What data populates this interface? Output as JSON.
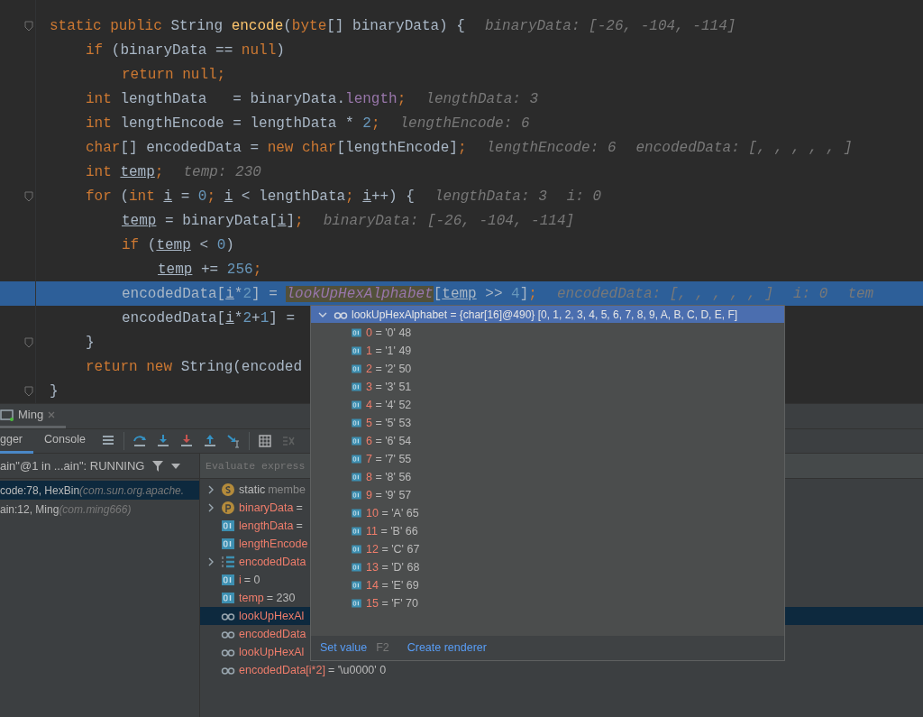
{
  "editor": {
    "lines": [
      {
        "tokens": [
          {
            "text": "static public ",
            "kind": "keyword"
          },
          {
            "text": "String ",
            "kind": "plain"
          },
          {
            "text": "encode",
            "kind": "method"
          },
          {
            "text": "(",
            "kind": "plain"
          },
          {
            "text": "byte",
            "kind": "keyword"
          },
          {
            "text": "[] binaryData) {",
            "kind": "plain"
          }
        ],
        "hints": [
          "binaryData: [-26, -104, -114]"
        ],
        "current": false,
        "fold": true,
        "children": [
          {
            "tokens": [
              {
                "text": "if",
                "kind": "keyword"
              },
              {
                "text": " (binaryData == ",
                "kind": "plain"
              },
              {
                "text": "null",
                "kind": "keyword"
              },
              {
                "text": ")",
                "kind": "plain"
              }
            ],
            "current": false,
            "fold": false,
            "children": [
              {
                "tokens": [
                  {
                    "text": "return null;",
                    "kind": "keyword"
                  }
                ],
                "current": false,
                "fold": false
              }
            ]
          },
          {
            "tokens": [
              {
                "text": "int",
                "kind": "keyword"
              },
              {
                "text": " lengthData   = binaryData.",
                "kind": "plain"
              },
              {
                "text": "length",
                "kind": "field"
              },
              {
                "text": ";",
                "kind": "keyword"
              }
            ],
            "hints": [
              "lengthData: 3"
            ],
            "current": false,
            "fold": false
          },
          {
            "tokens": [
              {
                "text": "int",
                "kind": "keyword"
              },
              {
                "text": " lengthEncode = lengthData * ",
                "kind": "plain"
              },
              {
                "text": "2",
                "kind": "number"
              },
              {
                "text": ";",
                "kind": "keyword"
              }
            ],
            "hints": [
              "lengthEncode: 6"
            ],
            "current": false,
            "fold": false
          },
          {
            "tokens": [
              {
                "text": "char",
                "kind": "keyword"
              },
              {
                "text": "[] encodedData = ",
                "kind": "plain"
              },
              {
                "text": "new char",
                "kind": "keyword"
              },
              {
                "text": "[lengthEncode]",
                "kind": "plain"
              },
              {
                "text": ";",
                "kind": "keyword"
              }
            ],
            "hints": [
              "lengthEncode: 6",
              "encodedData: [, , , , , ]"
            ],
            "current": false,
            "fold": false
          },
          {
            "tokens": [
              {
                "text": "int ",
                "kind": "keyword"
              },
              {
                "text": "temp",
                "kind": "variable"
              },
              {
                "text": ";",
                "kind": "keyword"
              }
            ],
            "hints": [
              "temp: 230"
            ],
            "current": false,
            "fold": false
          },
          {
            "tokens": [
              {
                "text": "for",
                "kind": "keyword"
              },
              {
                "text": " (",
                "kind": "plain"
              },
              {
                "text": "int ",
                "kind": "keyword"
              },
              {
                "text": "i",
                "kind": "variable"
              },
              {
                "text": " = ",
                "kind": "plain"
              },
              {
                "text": "0",
                "kind": "number"
              },
              {
                "text": "; ",
                "kind": "keyword"
              },
              {
                "text": "i",
                "kind": "variable"
              },
              {
                "text": " < lengthData",
                "kind": "plain"
              },
              {
                "text": "; ",
                "kind": "keyword"
              },
              {
                "text": "i",
                "kind": "variable"
              },
              {
                "text": "++) {",
                "kind": "plain"
              }
            ],
            "hints": [
              "lengthData: 3",
              "i: 0"
            ],
            "current": false,
            "fold": true,
            "children": [
              {
                "tokens": [
                  {
                    "text": "temp",
                    "kind": "variable"
                  },
                  {
                    "text": " = binaryData[",
                    "kind": "plain"
                  },
                  {
                    "text": "i",
                    "kind": "variable"
                  },
                  {
                    "text": "]",
                    "kind": "plain"
                  },
                  {
                    "text": ";",
                    "kind": "keyword"
                  }
                ],
                "hints": [
                  "binaryData: [-26, -104, -114]"
                ],
                "current": false,
                "fold": false
              },
              {
                "tokens": [
                  {
                    "text": "if",
                    "kind": "keyword"
                  },
                  {
                    "text": " (",
                    "kind": "plain"
                  },
                  {
                    "text": "temp",
                    "kind": "variable"
                  },
                  {
                    "text": " < ",
                    "kind": "plain"
                  },
                  {
                    "text": "0",
                    "kind": "number"
                  },
                  {
                    "text": ")",
                    "kind": "plain"
                  }
                ],
                "current": false,
                "fold": false,
                "children": [
                  {
                    "tokens": [
                      {
                        "text": "temp",
                        "kind": "variable"
                      },
                      {
                        "text": " += ",
                        "kind": "plain"
                      },
                      {
                        "text": "256",
                        "kind": "number"
                      },
                      {
                        "text": ";",
                        "kind": "keyword"
                      }
                    ],
                    "current": false,
                    "fold": false
                  }
                ]
              },
              {
                "tokens": [
                  {
                    "text": "encodedData[",
                    "kind": "plain"
                  },
                  {
                    "text": "i",
                    "kind": "variable"
                  },
                  {
                    "text": "*",
                    "kind": "plain"
                  },
                  {
                    "text": "2",
                    "kind": "number"
                  },
                  {
                    "text": "] = ",
                    "kind": "plain"
                  },
                  {
                    "text": "lookUpHexAlphabet",
                    "kind": "static"
                  },
                  {
                    "text": "[",
                    "kind": "plain"
                  },
                  {
                    "text": "temp",
                    "kind": "variable"
                  },
                  {
                    "text": " >> ",
                    "kind": "plain"
                  },
                  {
                    "text": "4",
                    "kind": "number"
                  },
                  {
                    "text": "]",
                    "kind": "plain"
                  },
                  {
                    "text": ";",
                    "kind": "keyword"
                  }
                ],
                "hints": [
                  "encodedData: [, , , , , ]",
                  "i: 0",
                  "tem"
                ],
                "current": true,
                "fold": false
              },
              {
                "tokens": [
                  {
                    "text": "encodedData[",
                    "kind": "plain"
                  },
                  {
                    "text": "i",
                    "kind": "variable"
                  },
                  {
                    "text": "*",
                    "kind": "plain"
                  },
                  {
                    "text": "2",
                    "kind": "number"
                  },
                  {
                    "text": "+",
                    "kind": "plain"
                  },
                  {
                    "text": "1",
                    "kind": "number"
                  },
                  {
                    "text": "] =",
                    "kind": "plain"
                  }
                ],
                "current": false,
                "fold": false
              }
            ]
          },
          {
            "tokens": [
              {
                "text": "}",
                "kind": "plain"
              }
            ],
            "current": false,
            "fold": true
          },
          {
            "tokens": [
              {
                "text": "return new ",
                "kind": "keyword"
              },
              {
                "text": "String(encoded",
                "kind": "plain"
              }
            ],
            "current": false,
            "fold": false
          }
        ]
      },
      {
        "tokens": [
          {
            "text": "}",
            "kind": "plain"
          }
        ],
        "current": false,
        "fold": true
      }
    ]
  },
  "popup": {
    "header": {
      "name": "lookUpHexAlphabet",
      "value": " = {char[16]@490} [0, 1, 2, 3, 4, 5, 6, 7, 8, 9, A, B, C, D, E, F]",
      "expanded": true
    },
    "items": [
      {
        "index": "0",
        "value": " = '0' 48"
      },
      {
        "index": "1",
        "value": " = '1' 49"
      },
      {
        "index": "2",
        "value": " = '2' 50"
      },
      {
        "index": "3",
        "value": " = '3' 51"
      },
      {
        "index": "4",
        "value": " = '4' 52"
      },
      {
        "index": "5",
        "value": " = '5' 53"
      },
      {
        "index": "6",
        "value": " = '6' 54"
      },
      {
        "index": "7",
        "value": " = '7' 55"
      },
      {
        "index": "8",
        "value": " = '8' 56"
      },
      {
        "index": "9",
        "value": " = '9' 57"
      },
      {
        "index": "10",
        "value": " = 'A' 65"
      },
      {
        "index": "11",
        "value": " = 'B' 66"
      },
      {
        "index": "12",
        "value": " = 'C' 67"
      },
      {
        "index": "13",
        "value": " = 'D' 68"
      },
      {
        "index": "14",
        "value": " = 'E' 69"
      },
      {
        "index": "15",
        "value": " = 'F' 70"
      }
    ],
    "actions": [
      {
        "label": "Set value",
        "shortcut": "F2"
      },
      {
        "label": "Create renderer"
      }
    ]
  },
  "debug": {
    "session_tab": {
      "label": "Ming"
    },
    "tabs": [
      {
        "label": "gger",
        "selected": true
      },
      {
        "label": "Console",
        "selected": false
      }
    ],
    "thread": "ain\"@1 in ...ain\": RUNNING",
    "frames": [
      {
        "location": "code:78, HexBin",
        "package": "(com.sun.org.apache.",
        "selected": true
      },
      {
        "location": "ain:12, Ming",
        "package": "(com.ming666)",
        "selected": false
      }
    ],
    "evaluate": {
      "placeholder": "Evaluate express"
    },
    "variables": [
      {
        "kind": "static",
        "name": "static",
        "value": " membe",
        "expandable": true,
        "selected": false
      },
      {
        "kind": "param",
        "name": "binaryData",
        "value": " =",
        "expandable": true,
        "selected": false
      },
      {
        "kind": "primitive",
        "name": "lengthData",
        "value": " =",
        "expandable": false,
        "selected": false
      },
      {
        "kind": "primitive",
        "name": "lengthEncode",
        "expandable": false,
        "selected": false
      },
      {
        "kind": "array",
        "name": "encodedData",
        "expandable": true,
        "selected": false
      },
      {
        "kind": "primitive",
        "name": "i",
        "value": " = 0",
        "expandable": false,
        "selected": false
      },
      {
        "kind": "primitive",
        "name": "temp",
        "value": " = 230",
        "expandable": false,
        "selected": false
      },
      {
        "kind": "watch",
        "name": "lookUpHexAl",
        "expandable": false,
        "selected": true
      },
      {
        "kind": "watch",
        "name": "encodedData",
        "expandable": false,
        "selected": false
      },
      {
        "kind": "watch",
        "name": "lookUpHexAl",
        "expandable": false,
        "selected": false
      },
      {
        "kind": "watch",
        "name": "encodedData[i*2]",
        "value": " = '\\u0000' 0",
        "expandable": false,
        "selected": false
      }
    ]
  }
}
